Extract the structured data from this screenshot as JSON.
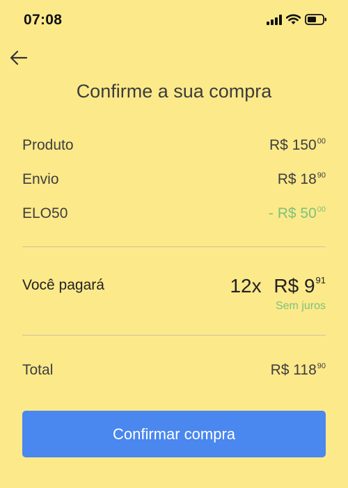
{
  "status_bar": {
    "time": "07:08",
    "icons": [
      "signal-icon",
      "wifi-icon",
      "battery-icon"
    ]
  },
  "header": {
    "back_icon": "back-arrow-icon",
    "title": "Confirme a sua compra"
  },
  "summary": {
    "rows": [
      {
        "label": "Produto",
        "currency": "R$",
        "whole": "150",
        "cents": "00"
      },
      {
        "label": "Envio",
        "currency": "R$",
        "whole": "18",
        "cents": "90"
      },
      {
        "label": "ELO50",
        "prefix": "-",
        "currency": "R$",
        "whole": "50",
        "cents": "00"
      }
    ]
  },
  "payment": {
    "label": "Você pagará",
    "installments": "12x",
    "currency": "R$",
    "whole": "9",
    "cents": "91",
    "note": "Sem juros"
  },
  "total": {
    "label": "Total",
    "currency": "R$",
    "whole": "118",
    "cents": "90"
  },
  "actions": {
    "confirm_label": "Confirmar compra"
  },
  "colors": {
    "background": "#fce98a",
    "accent_button": "#4a87ee",
    "discount_green": "#7fc17a",
    "text": "#3e3e3e"
  }
}
